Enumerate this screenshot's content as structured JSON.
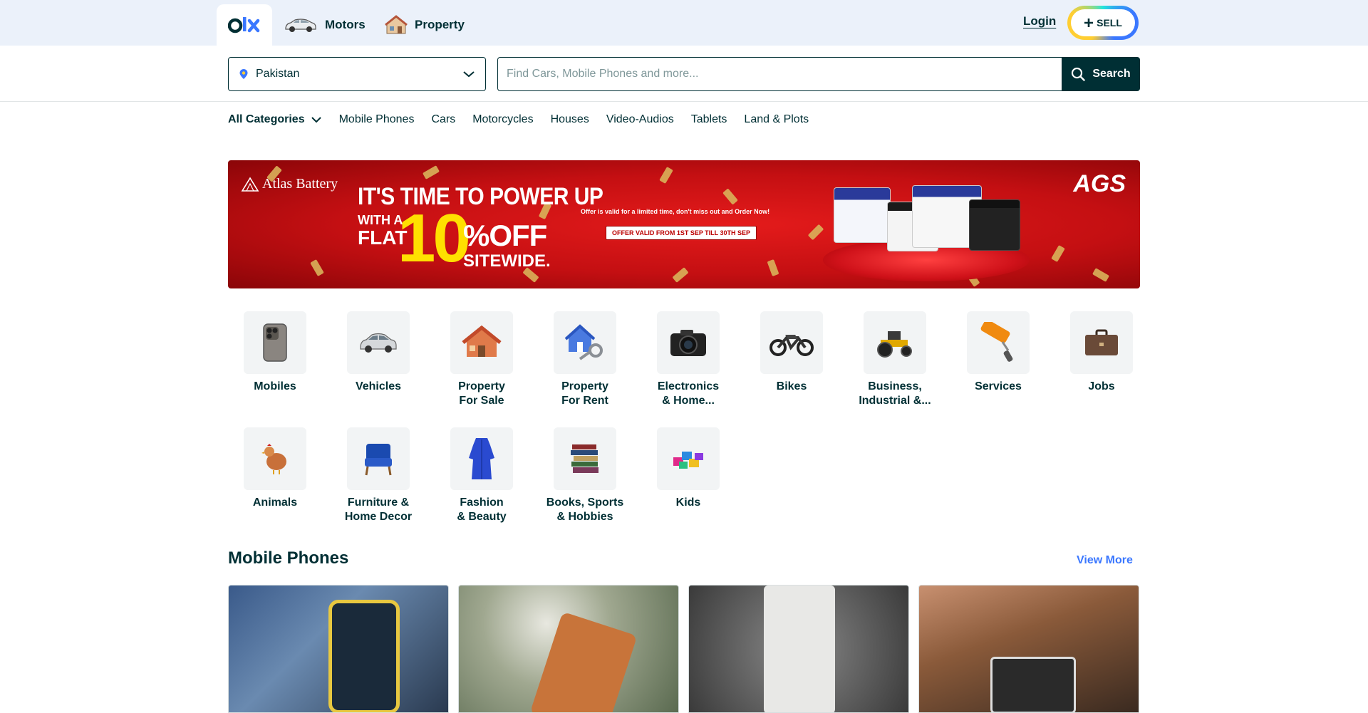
{
  "header": {
    "logo": "olx",
    "links": [
      {
        "label": "Motors",
        "icon": "car-icon"
      },
      {
        "label": "Property",
        "icon": "house-icon"
      }
    ],
    "login_label": "Login",
    "sell_label": "SELL"
  },
  "search": {
    "location_value": "Pakistan",
    "placeholder": "Find Cars, Mobile Phones and more...",
    "button_label": "Search"
  },
  "category_nav": {
    "all_label": "All Categories",
    "items": [
      "Mobile Phones",
      "Cars",
      "Motorcycles",
      "Houses",
      "Video-Audios",
      "Tablets",
      "Land & Plots"
    ]
  },
  "banner": {
    "brand": "Atlas Battery",
    "headline_1": "IT'S TIME TO POWER UP",
    "headline_2a": "WITH A",
    "headline_2b": "FLAT",
    "percent": "10",
    "off": "%OFF",
    "sitewide": "SITEWIDE.",
    "note": "Offer is valid for a limited time, don't miss out and Order Now!",
    "validity": "OFFER VALID FROM 1ST SEP TILL 30TH SEP",
    "logo": "AGS"
  },
  "categories": [
    {
      "label": "Mobiles",
      "icon": "mobile-phone-icon"
    },
    {
      "label": "Vehicles",
      "icon": "car-icon"
    },
    {
      "label": "Property\nFor Sale",
      "icon": "house-icon"
    },
    {
      "label": "Property\nFor Rent",
      "icon": "house-key-icon"
    },
    {
      "label": "Electronics\n& Home...",
      "icon": "camera-icon"
    },
    {
      "label": "Bikes",
      "icon": "motorbike-icon"
    },
    {
      "label": "Business,\nIndustrial &...",
      "icon": "tractor-icon"
    },
    {
      "label": "Services",
      "icon": "paint-roller-icon"
    },
    {
      "label": "Jobs",
      "icon": "briefcase-icon"
    },
    {
      "label": "Animals",
      "icon": "hen-icon"
    },
    {
      "label": "Furniture &\nHome Decor",
      "icon": "armchair-icon"
    },
    {
      "label": "Fashion\n& Beauty",
      "icon": "dress-icon"
    },
    {
      "label": "Books, Sports\n& Hobbies",
      "icon": "books-icon"
    },
    {
      "label": "Kids",
      "icon": "blocks-icon"
    }
  ],
  "mobile_section": {
    "title": "Mobile Phones",
    "view_more": "View More"
  },
  "colors": {
    "brand_dark": "#002f34",
    "accent_blue": "#3a77ff",
    "topbar_bg": "#ebf1fa",
    "banner_red": "#c40f12",
    "banner_yellow": "#ffe000"
  }
}
